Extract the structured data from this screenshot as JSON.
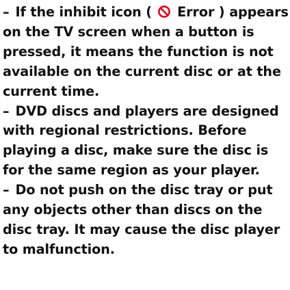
{
  "notes": [
    {
      "dash": "–",
      "before_icon": "If the inhibit icon (",
      "icon": "inhibit-icon",
      "icon_label": "Error )",
      "after_icon": "appears on the TV screen when a button is pressed, it means the function is not available on the current disc or at the current time."
    },
    {
      "dash": "–",
      "text": "DVD discs and players are designed with regional restrictions. Before playing a disc, make sure the disc is for the same region as your player."
    },
    {
      "dash": "–",
      "text": "Do not push on the disc tray or put any objects other than discs on the disc tray. It may cause the disc player to malfunction."
    }
  ],
  "colors": {
    "text": "#111111",
    "icon": "#e2001a",
    "background": "#ffffff"
  }
}
